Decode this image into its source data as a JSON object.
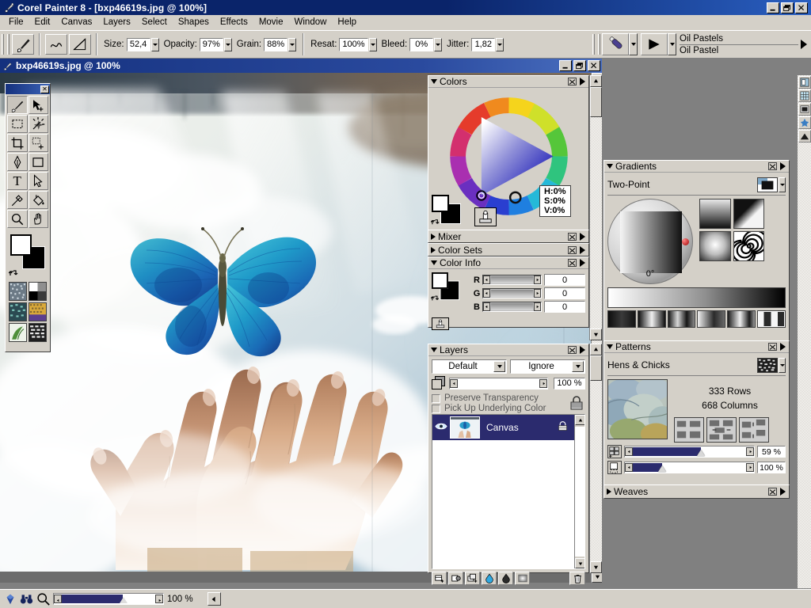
{
  "window": {
    "app_icon": "painter-brush-icon",
    "title": "Corel Painter 8 - [bxp46619s.jpg @ 100%]",
    "minimize_label": "_",
    "restore_label": "❐",
    "close_label": "✕"
  },
  "menu": {
    "items": [
      {
        "label": "File"
      },
      {
        "label": "Edit"
      },
      {
        "label": "Canvas"
      },
      {
        "label": "Layers"
      },
      {
        "label": "Select"
      },
      {
        "label": "Shapes"
      },
      {
        "label": "Effects"
      },
      {
        "label": "Movie"
      },
      {
        "label": "Window"
      },
      {
        "label": "Help"
      }
    ]
  },
  "property_bar": {
    "brush_tool_icon": "paintbrush-icon",
    "stroke_icon": "freehand-stroke-icon",
    "line_icon": "straight-line-stroke-icon",
    "fields": [
      {
        "label": "Size:",
        "value": "52,4"
      },
      {
        "label": "Opacity:",
        "value": "97%"
      },
      {
        "label": "Grain:",
        "value": "88%"
      },
      {
        "label": "Resat:",
        "value": "100%"
      },
      {
        "label": "Bleed:",
        "value": "0%"
      },
      {
        "label": "Jitter:",
        "value": "1,82"
      }
    ],
    "brush_selector": {
      "category_icon": "oil-pastel-brush-icon",
      "variant_icon": "brush-variant-icon",
      "category": "Oil Pastels",
      "variant": "Oil Pastel"
    }
  },
  "document": {
    "icon": "document-icon",
    "title": "bxp46619s.jpg @ 100%",
    "artwork_alt": "blue butterfly above two open hands in clouds"
  },
  "toolbox": {
    "close_label": "✕",
    "tools": [
      {
        "name": "brush-tool",
        "icon": "paintbrush-icon",
        "active": true
      },
      {
        "name": "layer-adjuster-tool",
        "icon": "layer-adjuster-icon",
        "active": false
      },
      {
        "name": "rectangular-selection-tool",
        "icon": "rect-selection-icon",
        "active": false
      },
      {
        "name": "magic-wand-tool",
        "icon": "magic-wand-icon",
        "active": false
      },
      {
        "name": "crop-tool",
        "icon": "crop-icon",
        "active": false
      },
      {
        "name": "selection-adjuster-tool",
        "icon": "selection-adjuster-icon",
        "active": false
      },
      {
        "name": "pen-tool",
        "icon": "pen-icon",
        "active": false
      },
      {
        "name": "rectangular-shape-tool",
        "icon": "rectangle-shape-icon",
        "active": false
      },
      {
        "name": "text-tool",
        "icon": "text-icon",
        "active": false
      },
      {
        "name": "shape-selection-tool",
        "icon": "arrow-pointer-icon",
        "active": false
      },
      {
        "name": "dropper-tool",
        "icon": "eyedropper-icon",
        "active": false
      },
      {
        "name": "paint-bucket-tool",
        "icon": "paint-bucket-icon",
        "active": false
      },
      {
        "name": "magnifier-tool",
        "icon": "magnifier-icon",
        "active": false
      },
      {
        "name": "grabber-tool",
        "icon": "hand-icon",
        "active": false
      }
    ],
    "colors": {
      "front_color": "#ffffff",
      "back_color": "#000000",
      "swap_icon": "swap-colors-icon"
    },
    "media": [
      {
        "name": "paper-selector",
        "icon": "paper-texture-icon"
      },
      {
        "name": "gradient-selector",
        "icon": "gradient-swatch-icon"
      },
      {
        "name": "pattern-selector",
        "icon": "pattern-swatch-icon"
      },
      {
        "name": "weave-selector",
        "icon": "weave-swatch-icon"
      },
      {
        "name": "nozzle-selector",
        "icon": "nozzle-swatch-icon"
      },
      {
        "name": "look-selector",
        "icon": "look-swatch-icon"
      }
    ]
  },
  "palettes": {
    "colors": {
      "title": "Colors",
      "expanded": true,
      "hsv": {
        "h": "H:0%",
        "s": "S:0%",
        "v": "V:0%"
      },
      "front_color": "#ffffff",
      "back_color": "#000000",
      "clone_color_icon": "clone-color-icon"
    },
    "mixer": {
      "title": "Mixer",
      "expanded": false
    },
    "color_sets": {
      "title": "Color Sets",
      "expanded": false
    },
    "color_info": {
      "title": "Color Info",
      "expanded": true,
      "channels": [
        {
          "label": "R",
          "value": "0"
        },
        {
          "label": "G",
          "value": "0"
        },
        {
          "label": "B",
          "value": "0"
        }
      ]
    },
    "layers": {
      "title": "Layers",
      "expanded": true,
      "composite_method": "Default",
      "composite_depth": "Ignore",
      "opacity": "100 %",
      "preserve_transparency": {
        "label": "Preserve Transparency",
        "checked": false
      },
      "pick_up_underlying": {
        "label": "Pick Up Underlying Color",
        "checked": false
      },
      "lock_icon": "lock-icon",
      "items": [
        {
          "name": "Canvas",
          "selected": true,
          "visible": true,
          "locked": true
        }
      ],
      "buttons": [
        {
          "name": "new-layer-button",
          "icon": "new-layer-icon"
        },
        {
          "name": "layer-properties-button",
          "icon": "layer-properties-icon"
        },
        {
          "name": "duplicate-layer-button",
          "icon": "duplicate-layer-icon"
        },
        {
          "name": "new-watercolor-layer-button",
          "icon": "watercolor-layer-icon"
        },
        {
          "name": "new-liquid-ink-layer-button",
          "icon": "liquid-ink-layer-icon"
        },
        {
          "name": "layer-mask-button",
          "icon": "layer-mask-icon"
        },
        {
          "name": "delete-layer-button",
          "icon": "trash-icon"
        }
      ]
    },
    "gradients": {
      "title": "Gradients",
      "expanded": true,
      "selected": "Two-Point",
      "preview_icon": "two-point-gradient-icon",
      "angle": "0°",
      "types": [
        {
          "name": "linear-gradient-type",
          "icon": "linear-gradient-icon"
        },
        {
          "name": "bi-linear-gradient-type",
          "icon": "bi-linear-gradient-icon"
        },
        {
          "name": "radial-gradient-type",
          "icon": "radial-gradient-icon"
        },
        {
          "name": "spiral-gradient-type",
          "icon": "spiral-gradient-icon"
        }
      ]
    },
    "patterns": {
      "title": "Patterns",
      "expanded": true,
      "selected": "Hens & Chicks",
      "preview_icon": "pattern-preview-icon",
      "rows": "333 Rows",
      "columns": "668 Columns",
      "tiles": [
        {
          "name": "rectangular-tile-button",
          "icon": "rectangular-tile-icon"
        },
        {
          "name": "horizontal-offset-tile-button",
          "icon": "horizontal-offset-tile-icon"
        },
        {
          "name": "vertical-offset-tile-button",
          "icon": "vertical-offset-tile-icon"
        }
      ],
      "scale": {
        "icon": "pattern-scale-icon",
        "value": "59 %",
        "percent": 59
      },
      "offset": {
        "icon": "pattern-offset-icon",
        "value": "100 %",
        "percent": 28
      }
    },
    "weaves": {
      "title": "Weaves",
      "expanded": false
    }
  },
  "icon_strip": [
    {
      "name": "screen-mode-icon"
    },
    {
      "name": "grid-overlay-icon"
    },
    {
      "name": "tracing-paper-icon"
    },
    {
      "name": "impasto-icon"
    },
    {
      "name": "perspective-grid-icon"
    }
  ],
  "status_bar": {
    "brush_icon": "brush-status-icon",
    "binoculars_icon": "binoculars-icon",
    "magnifier_icon": "magnifier-icon",
    "zoom_value": "100 %",
    "zoom_percent": 62,
    "expand_icon": "collapse-arrow-icon"
  },
  "colors": {
    "title_bar_start": "#0a246a",
    "title_bar_end": "#2a5fc0",
    "face": "#d4d0c8",
    "selection": "#2b2b6e",
    "accent": "#15317e"
  }
}
